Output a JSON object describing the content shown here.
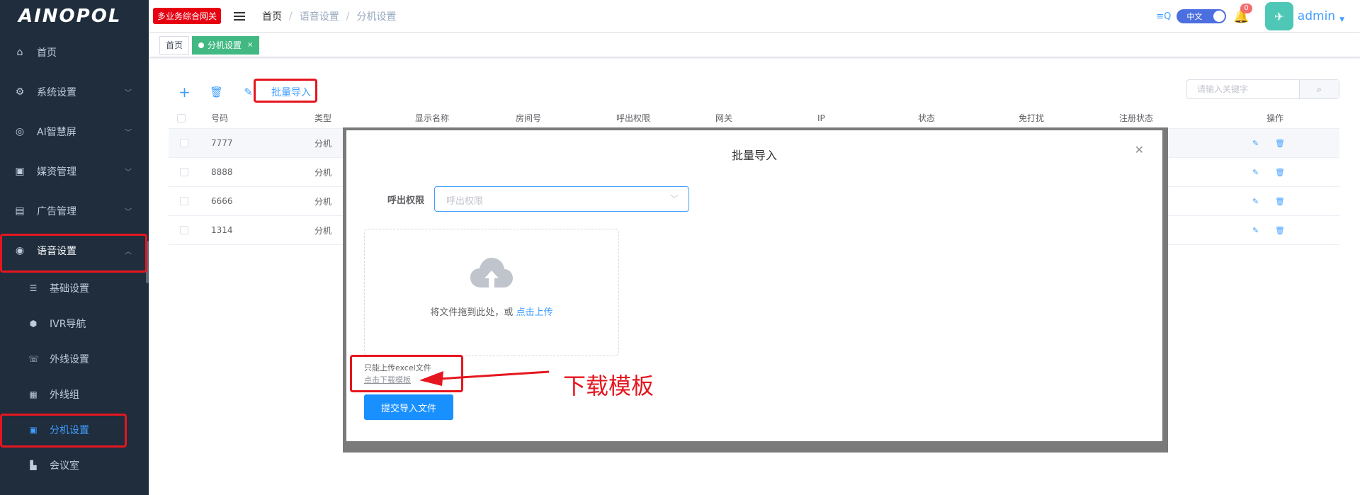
{
  "sidebar": {
    "logo": "AINOPOL",
    "items": [
      {
        "label": "首页",
        "icon": "home-icon"
      },
      {
        "label": "系统设置",
        "icon": "gear-icon"
      },
      {
        "label": "AI智慧屏",
        "icon": "ai-icon"
      },
      {
        "label": "媒资管理",
        "icon": "media-icon"
      },
      {
        "label": "广告管理",
        "icon": "ad-icon"
      },
      {
        "label": "语音设置",
        "icon": "voice-icon"
      }
    ],
    "sub_items": [
      {
        "label": "基础设置",
        "icon": "basic-settings-icon"
      },
      {
        "label": "IVR导航",
        "icon": "ivr-icon"
      },
      {
        "label": "外线设置",
        "icon": "phone-icon"
      },
      {
        "label": "外线组",
        "icon": "group-icon"
      },
      {
        "label": "分机设置",
        "icon": "extension-icon"
      },
      {
        "label": "会议室",
        "icon": "meeting-icon"
      }
    ]
  },
  "header": {
    "badge": "多业务综合网关",
    "breadcrumb": [
      "首页",
      "语音设置",
      "分机设置"
    ],
    "lang": "中文",
    "notif_count": "0",
    "user": "admin"
  },
  "tags": [
    {
      "label": "首页"
    },
    {
      "label": "分机设置"
    }
  ],
  "toolbar": {
    "import_label": "批量导入",
    "search_placeholder": "请输入关键字"
  },
  "table": {
    "columns": [
      "号码",
      "类型",
      "显示名称",
      "房间号",
      "呼出权限",
      "网关",
      "IP",
      "状态",
      "免打扰",
      "注册状态",
      "操作"
    ],
    "rows": [
      {
        "number": "7777",
        "type": "分机"
      },
      {
        "number": "8888",
        "type": "分机"
      },
      {
        "number": "6666",
        "type": "分机"
      },
      {
        "number": "1314",
        "type": "分机"
      }
    ]
  },
  "dialog": {
    "title": "批量导入",
    "field_label": "呼出权限",
    "field_placeholder": "呼出权限",
    "upload_text": "将文件拖到此处，或 ",
    "upload_link": "点击上传",
    "tip": "只能上传excel文件",
    "download_link": "点击下载模板",
    "submit": "提交导入文件"
  },
  "annotation": {
    "text": "下载模板",
    "color": "#e5161f"
  },
  "colors": {
    "sidebar_bg": "#1f2d3d",
    "accent": "#409eff",
    "tag_active": "#42b983",
    "annotation_red": "#e5161f"
  }
}
